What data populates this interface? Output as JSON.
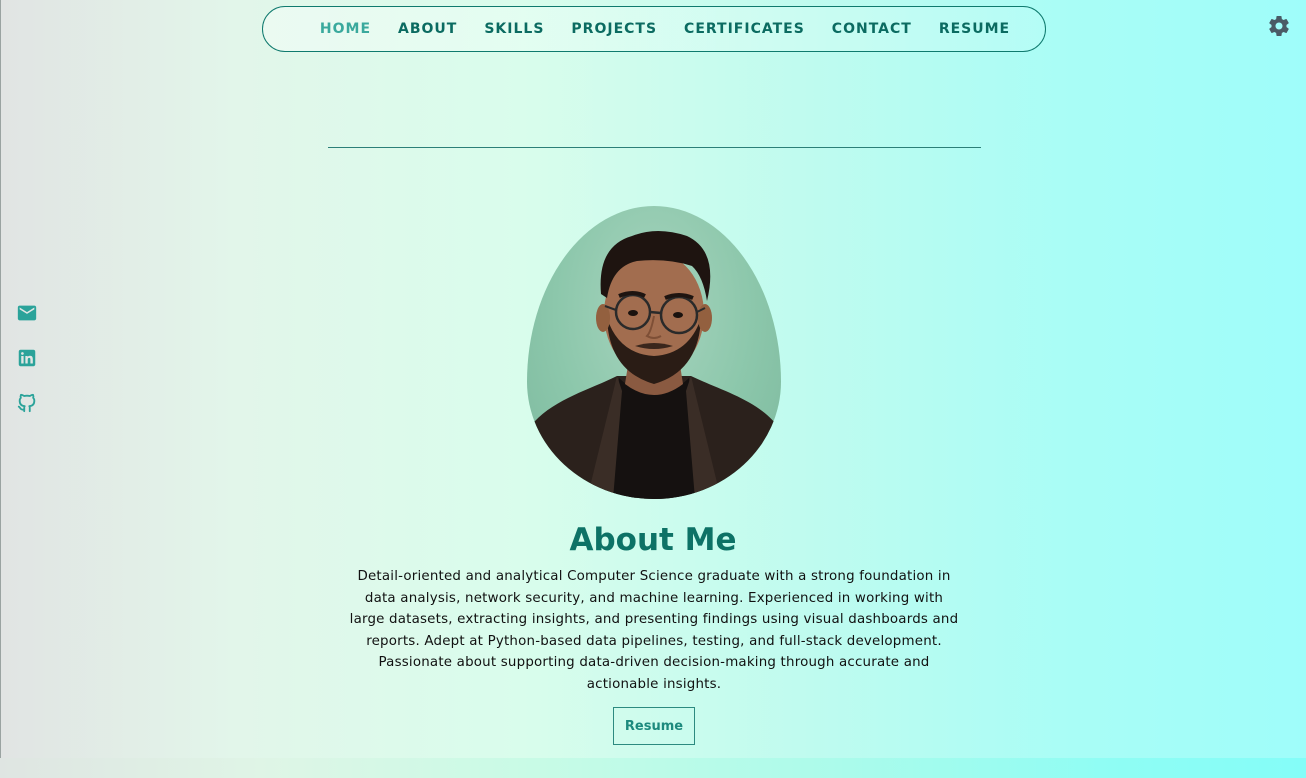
{
  "nav": {
    "items": [
      {
        "label": "HOME",
        "active": true
      },
      {
        "label": "ABOUT",
        "active": false
      },
      {
        "label": "SKILLS",
        "active": false
      },
      {
        "label": "PROJECTS",
        "active": false
      },
      {
        "label": "CERTIFICATES",
        "active": false
      },
      {
        "label": "CONTACT",
        "active": false
      },
      {
        "label": "RESUME",
        "active": false
      }
    ]
  },
  "settings": {
    "icon": "gear-icon"
  },
  "social": [
    {
      "icon": "email-icon"
    },
    {
      "icon": "linkedin-icon"
    },
    {
      "icon": "github-icon"
    }
  ],
  "about": {
    "title": "About Me",
    "lines": [
      "Detail-oriented and analytical Computer Science graduate with a strong foundation in",
      "data analysis, network security, and machine learning. Experienced in working with",
      "large datasets, extracting insights, and presenting findings using visual dashboards and",
      "reports. Adept at Python-based data pipelines, testing, and full-stack development.",
      "Passionate about supporting data-driven decision-making through accurate and",
      "actionable insights."
    ],
    "resume_button": "Resume"
  },
  "colors": {
    "accent": "#0b6b61",
    "active_nav": "#3aa99d",
    "social_icon": "#2ba39a",
    "gear": "#4a5b66"
  }
}
